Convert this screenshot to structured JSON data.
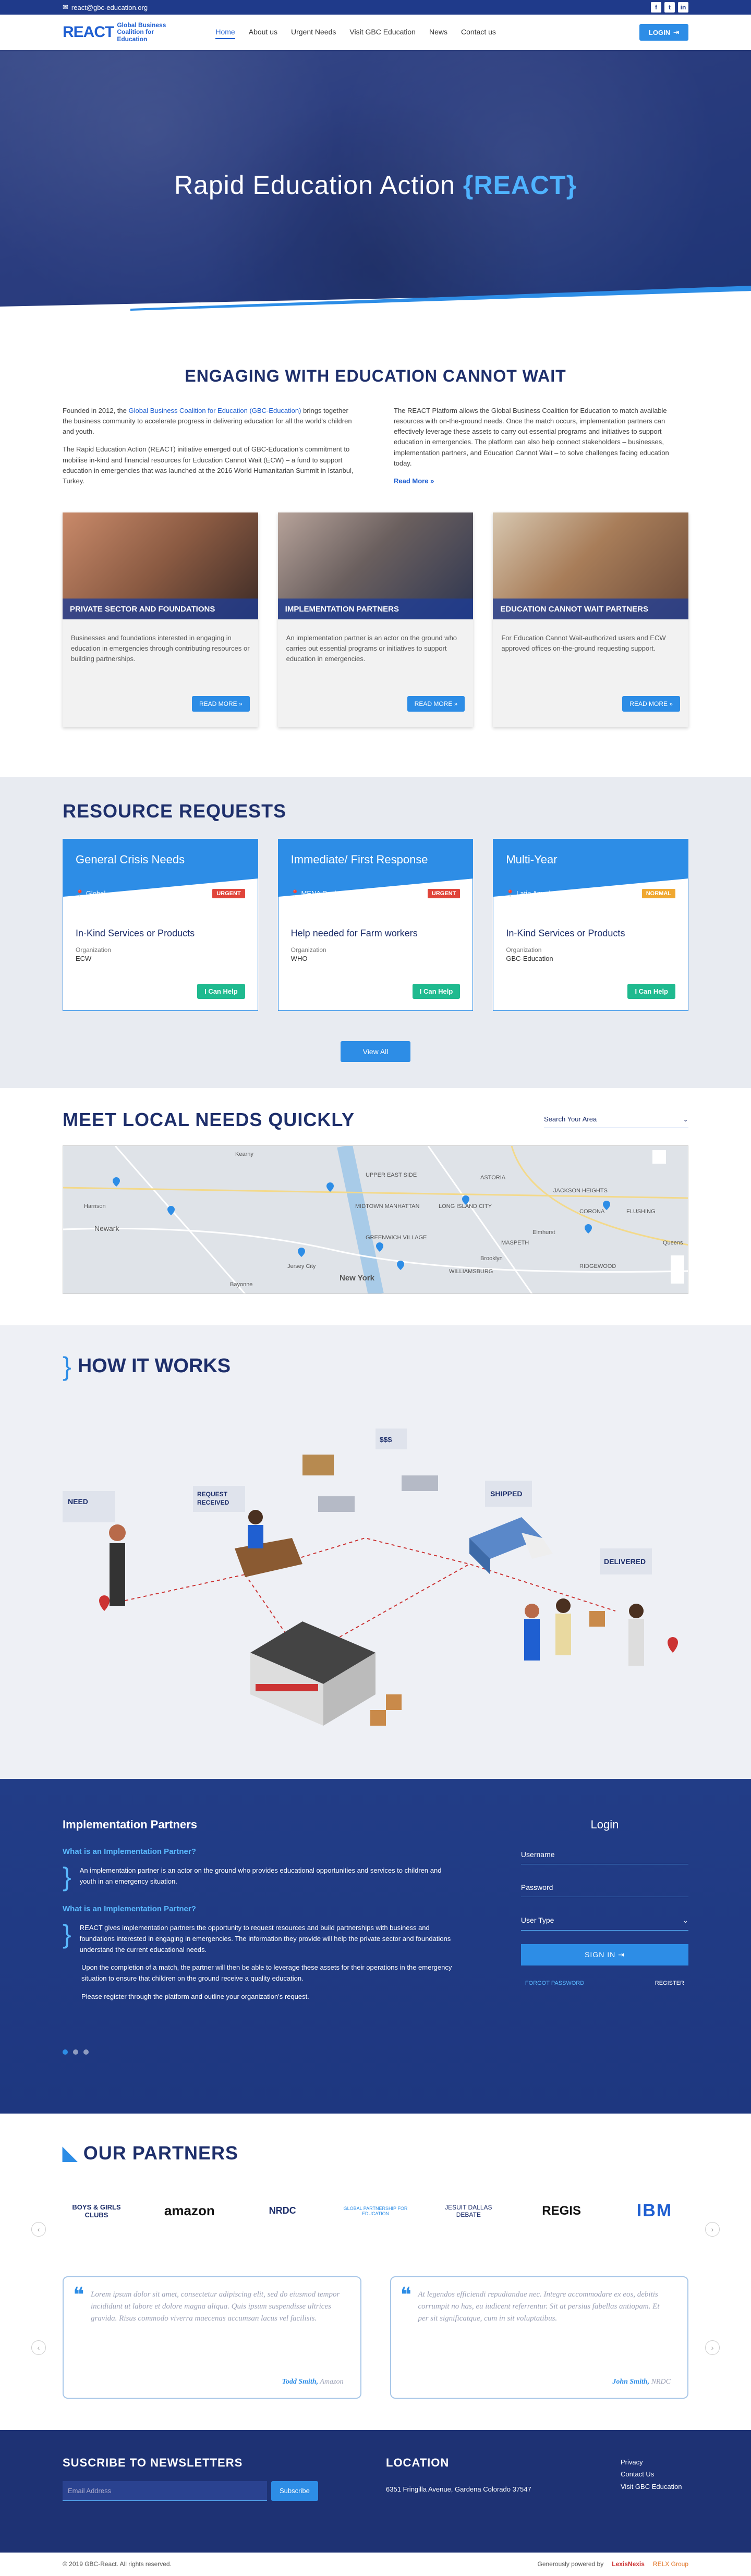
{
  "topbar": {
    "email": "react@gbc-education.org",
    "social": [
      "f",
      "t",
      "in"
    ]
  },
  "header": {
    "logo_mark": "REACT",
    "logo_text": [
      "Global Business",
      "Coalition for",
      "Education"
    ],
    "nav": [
      "Home",
      "About us",
      "Urgent Needs",
      "Visit GBC Education",
      "News",
      "Contact us"
    ],
    "login": "LOGIN"
  },
  "hero": {
    "title": "Rapid Education Action",
    "title_accent": "{REACT}"
  },
  "engaging": {
    "title": "ENGAGING WITH EDUCATION CANNOT WAIT",
    "left_p1_a": "Founded in 2012, the ",
    "left_p1_link": "Global Business Coalition for Education (GBC-Education)",
    "left_p1_b": " brings together the business community to accelerate progress in delivering education for all the world's children and youth.",
    "left_p2": "The Rapid Education Action (REACT) initiative emerged out of GBC-Education's commitment to mobilise in-kind and financial resources for Education Cannot Wait (ECW) – a fund to support education in emergencies that was launched at the 2016 World Humanitarian Summit in Istanbul, Turkey.",
    "right_p1": "The REACT Platform allows the Global Business Coalition for Education to match available resources with on-the-ground needs. Once the match occurs, implementation partners can effectively leverage these assets to carry out essential programs and initiatives to support education in emergencies. The platform can also help connect stakeholders – businesses, implementation partners, and Education Cannot Wait – to solve challenges facing education today.",
    "read_more": "Read More »"
  },
  "roles": [
    {
      "title": "PRIVATE SECTOR AND FOUNDATIONS",
      "text": "Businesses and foundations interested in engaging in education in emergencies through contributing resources or building partnerships.",
      "btn": "READ MORE »"
    },
    {
      "title": "IMPLEMENTATION PARTNERS",
      "text": "An implementation partner is an actor on the ground who carries out essential programs or initiatives to support education in emergencies.",
      "btn": "READ MORE »"
    },
    {
      "title": "EDUCATION CANNOT WAIT PARTNERS",
      "text": "For Education Cannot Wait-authorized users and ECW approved offices on-the-ground requesting support.",
      "btn": "READ MORE »"
    }
  ],
  "resources": {
    "title": "RESOURCE REQUESTS",
    "cards": [
      {
        "heading": "General Crisis Needs",
        "location": "Global",
        "badge": "URGENT",
        "badge_color": "#e0443a",
        "need": "In-Kind Services or Products",
        "org_label": "Organization",
        "org": "ECW",
        "btn": "I Can Help"
      },
      {
        "heading": "Immediate/ First Response",
        "location": "MENA Region",
        "badge": "URGENT",
        "badge_color": "#e0443a",
        "need": "Help needed for Farm workers",
        "org_label": "Organization",
        "org": "WHO",
        "btn": "I Can Help"
      },
      {
        "heading": "Multi-Year",
        "location": "Latin America",
        "badge": "NORMAL",
        "badge_color": "#f0a830",
        "need": "In-Kind Services or Products",
        "org_label": "Organization",
        "org": "GBC-Education",
        "btn": "I Can Help"
      }
    ],
    "view_all": "View All"
  },
  "meet": {
    "title": "MEET LOCAL NEEDS QUICKLY",
    "search_placeholder": "Search Your Area",
    "map_labels": [
      "Kearny",
      "Jersey City",
      "New York",
      "Newark",
      "Queens",
      "Brooklyn",
      "Harrison",
      "UPPER EAST SIDE",
      "LONG ISLAND CITY",
      "ASTORIA",
      "JACKSON HEIGHTS",
      "Elmhurst",
      "FLUSHING",
      "Bayonne",
      "CORONA",
      "GREENWICH VILLAGE",
      "MIDTOWN MANHATTAN",
      "WILLIAMSBURG",
      "RIDGEWOOD",
      "MASPETH"
    ]
  },
  "how": {
    "title": "HOW IT WORKS",
    "labels": {
      "need": "NEED",
      "request": "REQUEST\nRECEIVED",
      "shipped": "SHIPPED",
      "delivered": "DELIVERED",
      "cost": "$$$"
    }
  },
  "impl": {
    "title": "Implementation Partners",
    "q1": "What is an Implementation Partner?",
    "p1": "An implementation partner is an actor on the ground who provides educational opportunities and services to children and youth in an emergency situation.",
    "q2": "What is an Implementation Partner?",
    "p2": "REACT gives implementation partners the opportunity to request resources and build partnerships with business and foundations interested in engaging in emergencies. The information they provide will help the private sector and foundations understand the current educational needs.",
    "p3": "Upon the completion of a match, the partner will then be able to leverage these assets for their operations in the emergency situation to ensure that children on the ground receive a quality education.",
    "p4": "Please register through the platform and outline your organization's request.",
    "login": {
      "title": "Login",
      "username": "Username",
      "password": "Password",
      "user_type": "User Type",
      "signin": "SIGN IN",
      "forgot": "FORGOT PASSWORD",
      "register": "REGISTER"
    }
  },
  "partners": {
    "title": "OUR PARTNERS",
    "logos": [
      "BOYS & GIRLS CLUBS",
      "amazon",
      "NRDC",
      "GLOBAL PARTNERSHIP FOR EDUCATION",
      "JESUIT DALLAS DEBATE",
      "REGIS",
      "IBM"
    ],
    "testimonials": [
      {
        "text": "Lorem ipsum dolor sit amet, consectetur adipiscing elit, sed do eiusmod tempor incididunt ut labore et dolore magna aliqua. Quis ipsum suspendisse ultrices gravida. Risus commodo viverra maecenas accumsan lacus vel facilisis.",
        "name": "Todd Smith,",
        "company": "Amazon"
      },
      {
        "text": "At legendos efficiendi repudiandae nec. Integre accommodare ex eos, debitis corrumpit no has, eu iudicent referrentur. Sit at persius fabellas antiopam. Et per sit significatque, cum in sit voluptatibus.",
        "name": "John Smith,",
        "company": "NRDC"
      }
    ]
  },
  "footer": {
    "newsletter_title": "SUSCRIBE TO NEWSLETTERS",
    "email_placeholder": "Email Address",
    "subscribe": "Subscribe",
    "location_title": "LOCATION",
    "address": "6351 Fringilla Avenue, Gardena Colorado 37547",
    "links": [
      "Privacy",
      "Contact Us",
      "Visit GBC Education"
    ],
    "copyright": "© 2019 GBC-React. All rights reserved.",
    "powered_by": "Generously powered by",
    "brand1": "LexisNexis",
    "brand2": "RELX Group"
  }
}
